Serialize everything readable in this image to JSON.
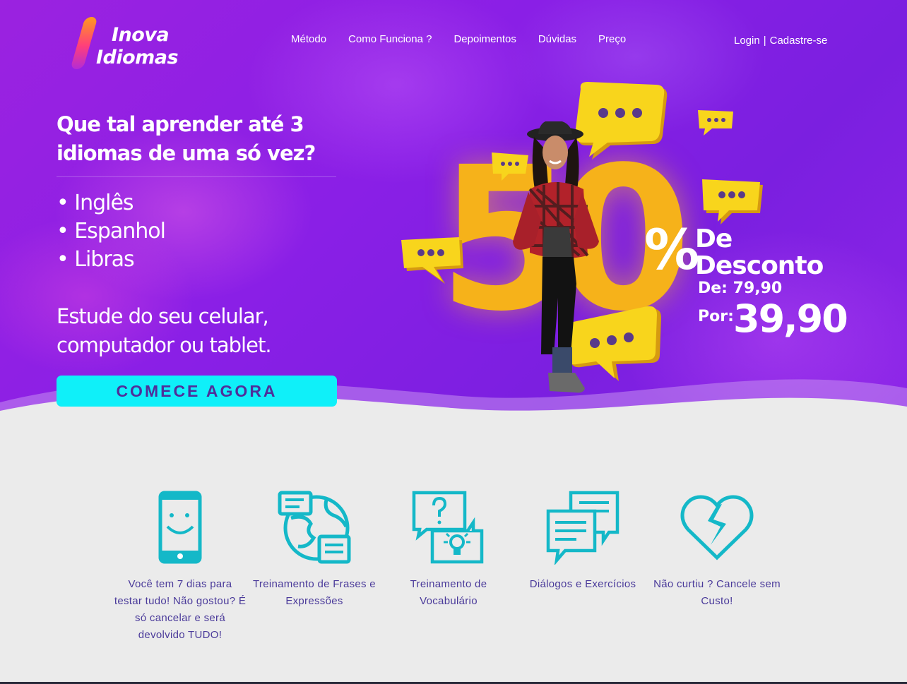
{
  "brand": {
    "line1": "Inova",
    "line2": "Idiomas"
  },
  "nav": {
    "items": [
      "Método",
      "Como Funciona ?",
      "Depoimentos",
      "Dúvidas",
      "Preço"
    ]
  },
  "auth": {
    "login": "Login",
    "separator": "|",
    "signup": "Cadastre-se"
  },
  "hero": {
    "headline": "Que tal aprender até 3 idiomas de uma só vez?",
    "languages": [
      "• Inglês",
      "• Espanhol",
      "• Libras"
    ],
    "study": "Estude do seu celular, computador ou tablet.",
    "cta": "COMECE AGORA"
  },
  "promo": {
    "big_number": "50",
    "percent": "%",
    "discount_line1": "De",
    "discount_line2": "Desconto",
    "price_from": "De: 79,90",
    "price_to_label": "Por:",
    "price_to": "39,90"
  },
  "features": [
    {
      "icon": "smartphone-smile-icon",
      "text": "Você tem 7 dias para testar tudo! Não gostou? É só cancelar e será devolvido TUDO!"
    },
    {
      "icon": "globe-chat-icon",
      "text": "Treinamento de Frases e Expressões"
    },
    {
      "icon": "question-idea-chat-icon",
      "text": "Treinamento de Vocabulário"
    },
    {
      "icon": "chat-bubbles-icon",
      "text": "Diálogos e Exercícios"
    },
    {
      "icon": "broken-heart-icon",
      "text": "Não curtiu ? Cancele sem Custo!"
    }
  ],
  "colors": {
    "hero_purple": "#8a1fe6",
    "cta_cyan": "#0ff0f9",
    "accent_yellow": "#f6c21a",
    "icon_teal": "#14b8c8",
    "feature_text": "#4a3a9a"
  }
}
